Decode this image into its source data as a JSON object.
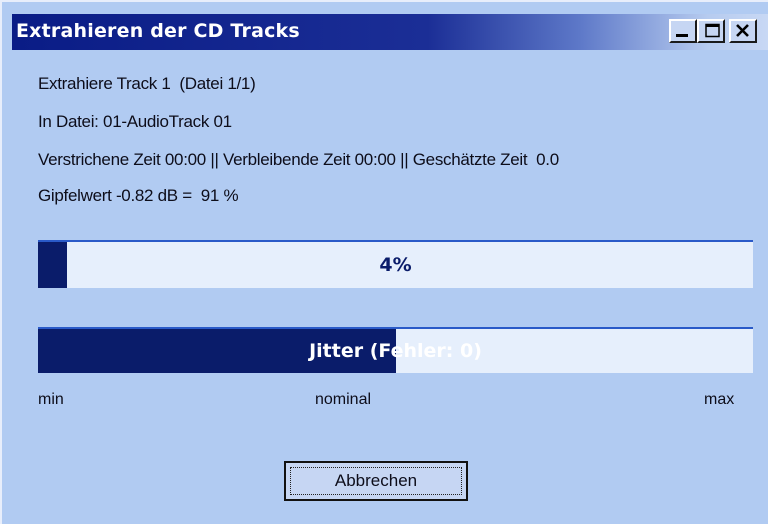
{
  "window": {
    "title": "Extrahieren der CD Tracks"
  },
  "info": {
    "line1": "Extrahiere Track 1  (Datei 1/1)",
    "line2": "In Datei: 01-AudioTrack 01",
    "line3": "Verstrichene Zeit 00:00 || Verbleibende Zeit 00:00 || Geschätzte Zeit  0.0",
    "line4": "Gipfelwert -0.82 dB =  91 %"
  },
  "progress": {
    "value_percent": 4,
    "label": "4%"
  },
  "jitter": {
    "label": "Jitter (Fehler: 0)",
    "level_fraction": 0.5
  },
  "scale": {
    "min": "min",
    "nominal": "nominal",
    "max": "max"
  },
  "buttons": {
    "cancel": "Abbrechen"
  },
  "colors": {
    "window_bg": "#b1cbf2",
    "titlebar_start": "#0a1c86",
    "bar_fill": "#0a1c6a",
    "bar_bg": "#e6effc"
  },
  "icons": {
    "minimize": "minimize-icon",
    "maximize": "maximize-icon",
    "close": "close-icon"
  }
}
